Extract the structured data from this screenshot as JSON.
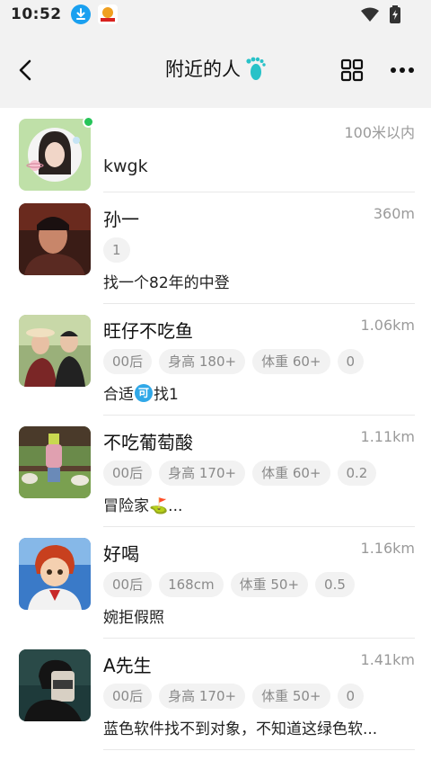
{
  "status_bar": {
    "time": "10:52",
    "icons": [
      "download-icon",
      "app-notification-icon",
      "wifi-icon",
      "battery-charging-icon"
    ]
  },
  "nav": {
    "title": "附近的人",
    "title_icon": "footprint-icon",
    "back_icon": "back-arrow-icon",
    "grid_icon": "grid-icon",
    "more_icon": "more-icon"
  },
  "colors": {
    "online": "#26c459",
    "accent": "#30a8e8",
    "tag_bg": "#f2f2f2",
    "muted_text": "#9a9a9a"
  },
  "me": {
    "name": "kwgk",
    "distance": "100米以内",
    "online": true
  },
  "people": [
    {
      "name": "孙一",
      "distance": "360m",
      "tags": [
        "1"
      ],
      "bio": "找一个82年的中登"
    },
    {
      "name": "旺仔不吃鱼",
      "distance": "1.06km",
      "tags": [
        "00后",
        "身高 180+",
        "体重 60+",
        "0"
      ],
      "bio_pre": "合适",
      "bio_badge": "可",
      "bio_post": "找1"
    },
    {
      "name": "不吃葡萄酸",
      "distance": "1.11km",
      "tags": [
        "00后",
        "身高 170+",
        "体重 60+",
        "0.2"
      ],
      "bio": "冒险家⛳..."
    },
    {
      "name": "好喝",
      "distance": "1.16km",
      "tags": [
        "00后",
        "168cm",
        "体重 50+",
        "0.5"
      ],
      "bio": "婉拒假照"
    },
    {
      "name": "A先生",
      "distance": "1.41km",
      "tags": [
        "00后",
        "身高 170+",
        "体重 50+",
        "0"
      ],
      "bio": "蓝色软件找不到对象，不知道这绿色软..."
    }
  ]
}
